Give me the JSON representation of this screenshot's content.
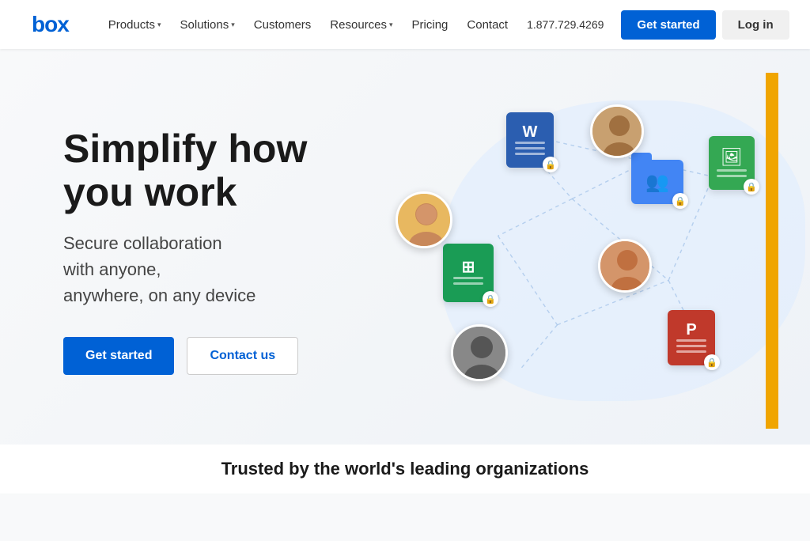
{
  "brand": {
    "name": "box",
    "color": "#0061d5"
  },
  "nav": {
    "links": [
      {
        "label": "Products",
        "has_dropdown": true
      },
      {
        "label": "Solutions",
        "has_dropdown": true
      },
      {
        "label": "Customers",
        "has_dropdown": false
      },
      {
        "label": "Resources",
        "has_dropdown": true
      },
      {
        "label": "Pricing",
        "has_dropdown": false
      },
      {
        "label": "Contact",
        "has_dropdown": false
      }
    ],
    "phone": "1.877.729.4269",
    "cta_label": "Get started",
    "login_label": "Log in"
  },
  "hero": {
    "title_line1": "Simplify how",
    "title_line2": "you work",
    "subtitle_line1": "Secure collaboration",
    "subtitle_line2": "with anyone,",
    "subtitle_line3": "anywhere, on any device",
    "cta_label": "Get started",
    "contact_label": "Contact us"
  },
  "trusted": {
    "label": "Trusted by the world's leading organizations"
  }
}
